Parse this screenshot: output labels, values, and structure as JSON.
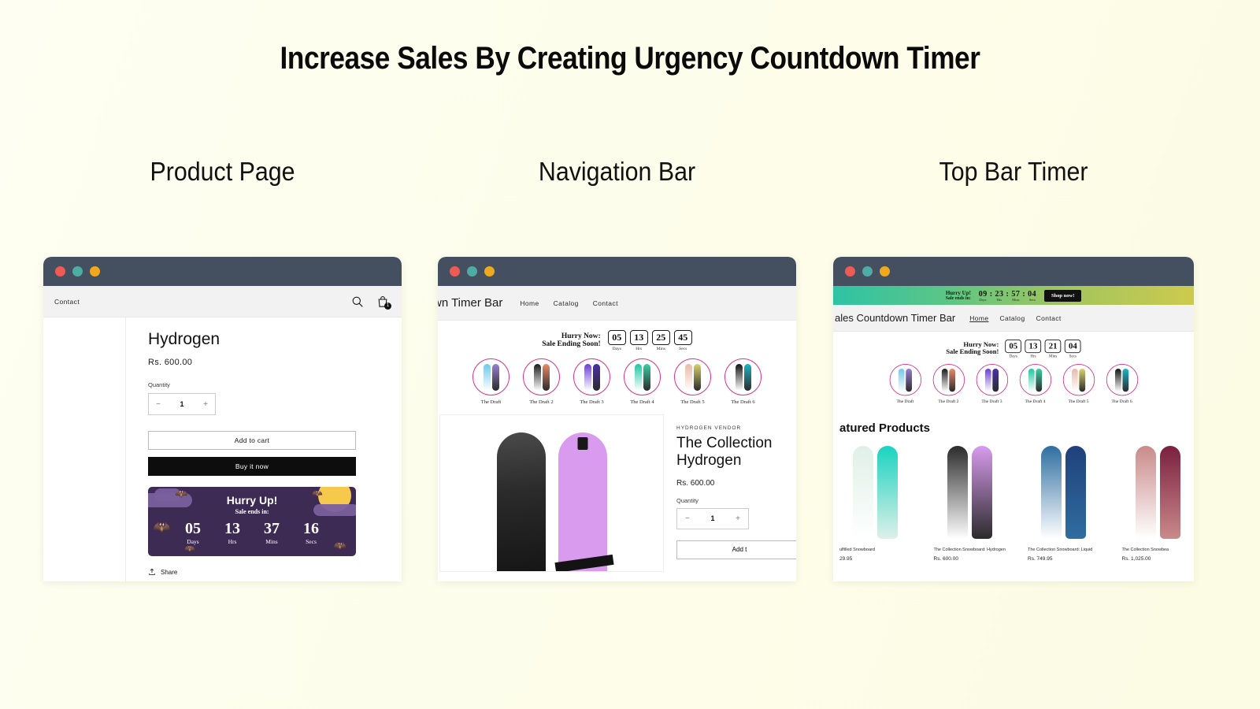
{
  "page": {
    "title": "Increase Sales By Creating Urgency Countdown Timer",
    "background_color": "#fdfdea"
  },
  "sections": [
    {
      "label": "Product Page"
    },
    {
      "label": "Navigation Bar"
    },
    {
      "label": "Top Bar Timer"
    }
  ],
  "panel1": {
    "header": {
      "nav_item": "Contact",
      "search_icon": "search-icon",
      "cart_icon": "shopping-bag-icon",
      "cart_count": "1"
    },
    "product": {
      "title": "Hydrogen",
      "price": "Rs. 600.00",
      "quantity_label": "Quantity",
      "quantity_minus": "−",
      "quantity_value": "1",
      "quantity_plus": "+",
      "add_to_cart": "Add to cart",
      "buy_now": "Buy it now",
      "share_label": "Share",
      "share_icon": "share-upload-icon"
    },
    "timer": {
      "theme": "halloween",
      "heading": "Hurry Up!",
      "subheading": "Sale ends in:",
      "bg_color": "#3e2b53",
      "moon_color": "#f6c84c",
      "cloud_color": "#7a5f9e",
      "units": [
        {
          "value": "05",
          "label": "Days"
        },
        {
          "value": "13",
          "label": "Hrs"
        },
        {
          "value": "37",
          "label": "Mins"
        },
        {
          "value": "16",
          "label": "Secs"
        }
      ]
    }
  },
  "panel2": {
    "header": {
      "store_name": "wn Timer Bar",
      "nav": [
        "Home",
        "Catalog",
        "Contact"
      ]
    },
    "timer": {
      "line1": "Hurry Now:",
      "line2": "Sale Ending Soon!",
      "units": [
        {
          "value": "05",
          "label": "Days"
        },
        {
          "value": "13",
          "label": "Hrs"
        },
        {
          "value": "25",
          "label": "Mins"
        },
        {
          "value": "45",
          "label": "Secs"
        }
      ]
    },
    "collection": [
      {
        "label": "The Draft",
        "color_a": "#6fc9e8",
        "color_b": "#9a7fd4"
      },
      {
        "label": "The Draft 2",
        "color_a": "#1c1c1c",
        "color_b": "#e98a6a"
      },
      {
        "label": "The Draft 3",
        "color_a": "#6b3fd4",
        "color_b": "#4b2fa8"
      },
      {
        "label": "The Draft 4",
        "color_a": "#1fc7a0",
        "color_b": "#3ad0a6"
      },
      {
        "label": "The Draft 5",
        "color_a": "#e9b9a8",
        "color_b": "#d9d36a"
      },
      {
        "label": "The Draft 6",
        "color_a": "#141414",
        "color_b": "#1fb4c4"
      }
    ],
    "product": {
      "vendor": "HYDROGEN VENDOR",
      "title_line1": "The Collection",
      "title_line2": "Hydrogen",
      "price": "Rs. 600.00",
      "quantity_label": "Quantity",
      "quantity_minus": "−",
      "quantity_value": "1",
      "quantity_plus": "+",
      "add_to_cart": "Add t"
    }
  },
  "panel3": {
    "topbar": {
      "line1": "Hurry Up!",
      "line2": "Sale ends in:",
      "time": "09 : 23 : 57 : 04",
      "unit_labels": [
        "Days",
        "Hrs",
        "Mins",
        "Secs"
      ],
      "cta": "Shop now!",
      "gradient_from": "#2ec3a5",
      "gradient_to": "#cdca4e"
    },
    "header": {
      "store_name": "ales Countdown Timer Bar",
      "nav": [
        "Home",
        "Catalog",
        "Contact"
      ]
    },
    "timer": {
      "line1": "Hurry Now:",
      "line2": "Sale Ending Soon!",
      "units": [
        {
          "value": "05",
          "label": "Days"
        },
        {
          "value": "13",
          "label": "Hrs"
        },
        {
          "value": "21",
          "label": "Mins"
        },
        {
          "value": "04",
          "label": "Secs"
        }
      ]
    },
    "collection": [
      {
        "label": "The Draft",
        "color_a": "#6fc9e8",
        "color_b": "#9a7fd4"
      },
      {
        "label": "The Draft 2",
        "color_a": "#1c1c1c",
        "color_b": "#e98a6a"
      },
      {
        "label": "The Draft 3",
        "color_a": "#6b3fd4",
        "color_b": "#4b2fa8"
      },
      {
        "label": "The Draft 4",
        "color_a": "#1fc7a0",
        "color_b": "#3ad0a6"
      },
      {
        "label": "The Draft 5",
        "color_a": "#e9b9a8",
        "color_b": "#d9d36a"
      },
      {
        "label": "The Draft 6",
        "color_a": "#141414",
        "color_b": "#1fb4c4"
      }
    ],
    "featured_heading": "atured Products",
    "featured": [
      {
        "name": "ulfilled Snowboard",
        "price": "29.95",
        "color_a": "#dff0e8",
        "color_b": "#19d3c0"
      },
      {
        "name": "The Collection Snowboard: Hydrogen",
        "price": "Rs. 600.00",
        "color_a": "#2b2b2b",
        "color_b": "#d89bee"
      },
      {
        "name": "The Collection Snowboard: Liquid",
        "price": "Rs. 749.95",
        "color_a": "#2f6ea0",
        "color_b": "#20407a"
      },
      {
        "name": "The Collection Snowbea",
        "price": "Rs. 1,025.00",
        "color_a": "#c98a8a",
        "color_b": "#7a2040"
      }
    ]
  },
  "window_dots": [
    "red",
    "teal",
    "amber"
  ]
}
